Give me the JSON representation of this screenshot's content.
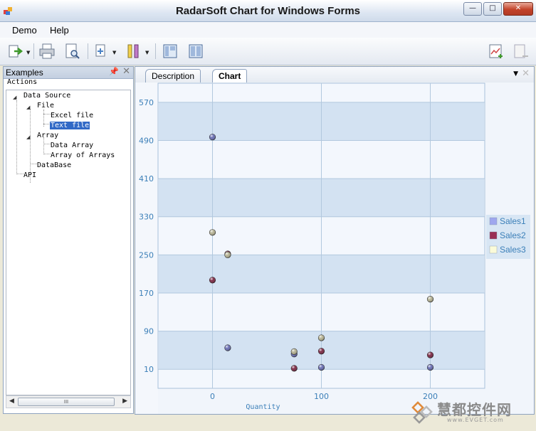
{
  "window": {
    "title": "RadarSoft Chart for Windows Forms",
    "buttons": {
      "minimize": "—",
      "maximize": "□",
      "close": "✕"
    }
  },
  "menu": {
    "items": [
      "Demo",
      "Help"
    ]
  },
  "toolbar": {
    "buttons": [
      "export-icon",
      "print-icon",
      "print-preview-icon",
      "copy-icon",
      "palette-icon",
      "layout-icon",
      "layout-split-icon",
      "add-chart-icon",
      "remove-chart-icon"
    ]
  },
  "left_panel": {
    "title": "Examples",
    "section": "Actions",
    "tree": [
      {
        "label": "Data Source",
        "level": 0,
        "expanded": true
      },
      {
        "label": "File",
        "level": 1,
        "expanded": true
      },
      {
        "label": "Excel file",
        "level": 2
      },
      {
        "label": "Text file",
        "level": 2,
        "selected": true
      },
      {
        "label": "Array",
        "level": 1,
        "expanded": true
      },
      {
        "label": "Data Array",
        "level": 2
      },
      {
        "label": "Array of Arrays",
        "level": 2
      },
      {
        "label": "DataBase",
        "level": 1
      },
      {
        "label": "API",
        "level": 0
      }
    ],
    "scroll_grip": "III"
  },
  "tabs": [
    {
      "label": "Description",
      "active": false
    },
    {
      "label": "Chart",
      "active": true
    }
  ],
  "chart_data": {
    "type": "scatter",
    "xlabel": "Quantity",
    "ylabel": "",
    "xlim": [
      -50,
      250
    ],
    "ylim": [
      -30,
      610
    ],
    "x_ticks": [
      "0",
      "100",
      "200"
    ],
    "y_ticks": [
      "10",
      "90",
      "170",
      "250",
      "330",
      "410",
      "490",
      "570"
    ],
    "grid": true,
    "legend_position": "right",
    "series": [
      {
        "name": "Sales1",
        "color": "#6a6fb4",
        "points": [
          [
            0,
            497
          ],
          [
            14,
            55
          ],
          [
            75,
            42
          ],
          [
            100,
            14
          ],
          [
            200,
            14
          ]
        ]
      },
      {
        "name": "Sales2",
        "color": "#7d2a46",
        "points": [
          [
            0,
            197
          ],
          [
            14,
            252
          ],
          [
            75,
            12
          ],
          [
            100,
            48
          ],
          [
            200,
            40
          ]
        ]
      },
      {
        "name": "Sales3",
        "color": "#b6b394",
        "points": [
          [
            0,
            297
          ],
          [
            14,
            250
          ],
          [
            75,
            47
          ],
          [
            100,
            76
          ],
          [
            200,
            157
          ]
        ]
      }
    ],
    "legend_colors": [
      "#9fa7ee",
      "#9a2f55",
      "#fbfbd9"
    ]
  },
  "watermark": {
    "text": "慧都控件网",
    "sub": "www.EVGET.com"
  }
}
